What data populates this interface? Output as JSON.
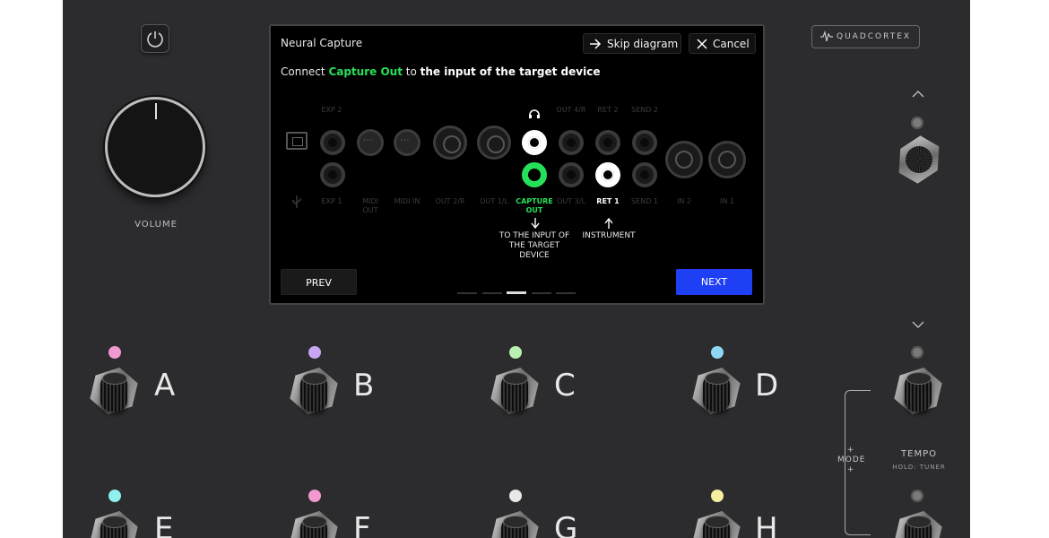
{
  "device": {
    "volume_label": "VOLUME",
    "logo_text": "QUADCORTEX",
    "chevron_up": "^",
    "chevron_down": "v"
  },
  "screen": {
    "title": "Neural Capture",
    "skip_label": "Skip diagram",
    "cancel_label": "Cancel",
    "instruction": {
      "prefix": "Connect ",
      "highlight": "Capture Out",
      "middle": " to ",
      "bold": "the input of the target device"
    },
    "ports_top": [
      "EXP 2",
      "OUT 4/R",
      "RET 2",
      "SEND 2"
    ],
    "ports_bottom": [
      "EXP 1",
      "MIDI OUT",
      "MIDI IN",
      "OUT 2/R",
      "OUT 1/L",
      "CAPTURE OUT",
      "OUT 3/L",
      "RET 1",
      "SEND 1",
      "IN 2",
      "IN 1"
    ],
    "note_capture": "TO THE INPUT OF THE TARGET DEVICE",
    "note_instrument": "INSTRUMENT",
    "prev_label": "PREV",
    "next_label": "NEXT",
    "steps_total": 5,
    "step_active": 3
  },
  "footswitches": [
    {
      "label": "A",
      "led": "#f29ad0"
    },
    {
      "label": "B",
      "led": "#c8a6f2"
    },
    {
      "label": "C",
      "led": "#b7f0b0"
    },
    {
      "label": "D",
      "led": "#8fd8f5"
    },
    {
      "label": "E",
      "led": "#8ff0ee"
    },
    {
      "label": "F",
      "led": "#f29ad0"
    },
    {
      "label": "G",
      "led": "#e8e8e8"
    },
    {
      "label": "H",
      "led": "#f5f0a0"
    }
  ],
  "right_panel": {
    "mode_label": "+ MODE +",
    "tempo_label": "TEMPO",
    "tuner_label": "HOLD: TUNER"
  }
}
